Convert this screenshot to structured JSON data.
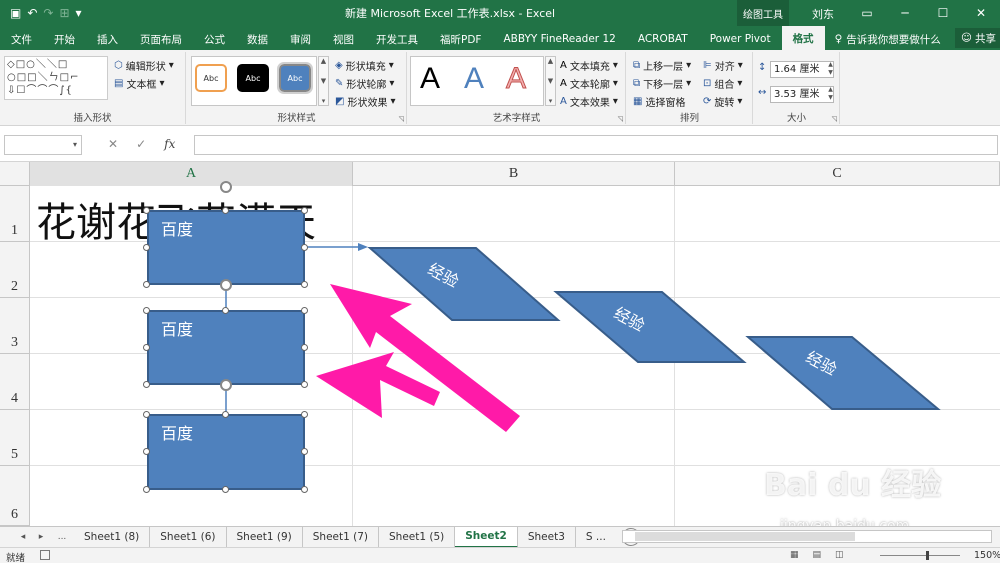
{
  "titlebar": {
    "title": "新建 Microsoft Excel 工作表.xlsx  -  Excel",
    "context_tab": "绘图工具",
    "user": "刘东",
    "qat": {
      "save": "▣",
      "undo": "↶",
      "redo": "↷",
      "custom": "▾"
    },
    "window": {
      "restore": "▭",
      "minimize": "─",
      "maximize": "☐",
      "close": "✕"
    }
  },
  "tabs": [
    {
      "label": "文件"
    },
    {
      "label": "开始"
    },
    {
      "label": "插入"
    },
    {
      "label": "页面布局"
    },
    {
      "label": "公式"
    },
    {
      "label": "数据"
    },
    {
      "label": "审阅"
    },
    {
      "label": "视图"
    },
    {
      "label": "开发工具"
    },
    {
      "label": "福昕PDF"
    },
    {
      "label": "ABBYY FineReader 12"
    },
    {
      "label": "ACROBAT"
    },
    {
      "label": "Power Pivot"
    },
    {
      "label": "格式"
    }
  ],
  "tell_me": "告诉我你想要做什么",
  "share": "共享",
  "ribbon": {
    "insert_shapes": {
      "label": "插入形状",
      "shape_rows": [
        "◇□○＼＼□",
        "○□□＼ㄣ□⌐",
        "⇩☐⌒⌒⌒∫{"
      ],
      "edit_shape": "编辑形状",
      "text_box": "文本框"
    },
    "shape_styles": {
      "label": "形状样式",
      "style1": "Abc",
      "style2": "Abc",
      "style3": "Abc",
      "fill": "形状填充",
      "outline": "形状轮廓",
      "effects": "形状效果"
    },
    "wordart": {
      "label": "艺术字样式",
      "a1": "A",
      "a2": "A",
      "a3": "A",
      "text_fill": "文本填充",
      "text_outline": "文本轮廓",
      "text_effects": "文本效果"
    },
    "arrange": {
      "label": "排列",
      "bring_forward": "上移一层",
      "send_backward": "下移一层",
      "selection_pane": "选择窗格",
      "align": "对齐",
      "group": "组合",
      "rotate": "旋转"
    },
    "size": {
      "label": "大小",
      "height": "1.64 厘米",
      "width": "3.53 厘米"
    }
  },
  "formula_bar": {
    "name_box": "▾",
    "cancel": "✕",
    "enter": "✓",
    "fx": "fx"
  },
  "grid": {
    "columns": [
      "A",
      "B",
      "C"
    ],
    "rows": [
      "1",
      "2",
      "3",
      "4",
      "5",
      "6"
    ],
    "a1_text": "花谢花飞花满天",
    "boxes": [
      "百度",
      "百度",
      "百度"
    ],
    "parallelograms": [
      "经验",
      "经验",
      "经验"
    ]
  },
  "sheet_tabs": {
    "nav_prev": "◂",
    "nav_next": "▸",
    "ellipsis": "...",
    "tabs": [
      "Sheet1 (8)",
      "Sheet1 (6)",
      "Sheet1 (9)",
      "Sheet1 (7)",
      "Sheet1 (5)",
      "Sheet2",
      "Sheet3",
      "S ..."
    ],
    "add": "+"
  },
  "status": {
    "ready": "就绪",
    "zoom": "150%"
  },
  "watermark": {
    "brand": "Bai du 经验",
    "url": "jingyan.baidu.com"
  },
  "colors": {
    "excel_green": "#217346",
    "shape_blue": "#4f81bd",
    "arrow_pink": "#ff1aa8"
  }
}
